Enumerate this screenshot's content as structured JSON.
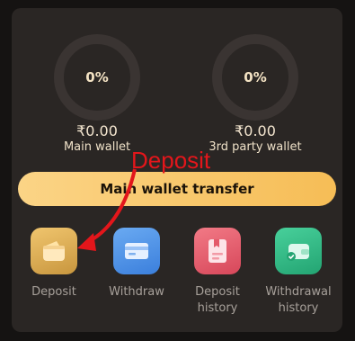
{
  "wallets": [
    {
      "percent": "0%",
      "amount": "₹0.00",
      "label": "Main wallet"
    },
    {
      "percent": "0%",
      "amount": "₹0.00",
      "label": "3rd party wallet"
    }
  ],
  "transfer_label": "Main wallet transfer",
  "annotation": "Deposit",
  "actions": [
    {
      "label": "Deposit",
      "icon": "wallet-icon",
      "color": "#d9a94e"
    },
    {
      "label": "Withdraw",
      "icon": "card-icon",
      "color": "#4a8fe6"
    },
    {
      "label": "Deposit history",
      "icon": "receipt-icon",
      "color": "#e45a6a"
    },
    {
      "label": "Withdrawal history",
      "icon": "wallet-check-icon",
      "color": "#2fb884"
    }
  ]
}
